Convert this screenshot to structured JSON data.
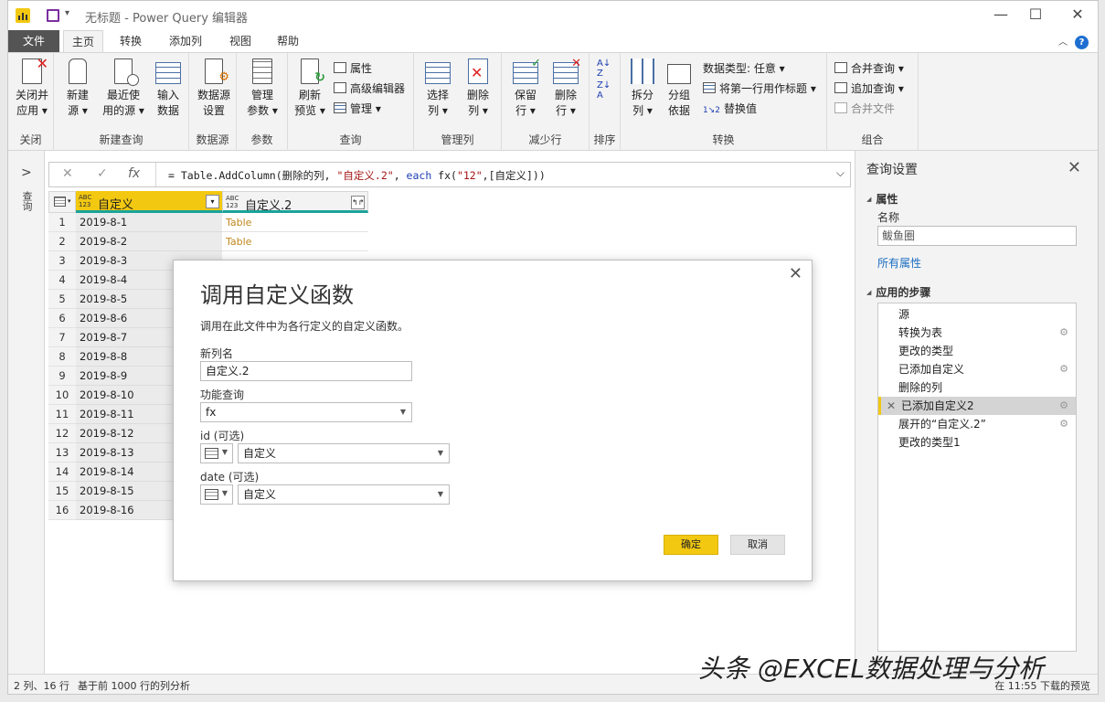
{
  "window": {
    "title": "无标题 - Power Query 编辑器",
    "controls": {
      "minimize": "—",
      "maximize": "☐",
      "close": "✕"
    }
  },
  "tabs": [
    {
      "label": "文件"
    },
    {
      "label": "主页"
    },
    {
      "label": "转换"
    },
    {
      "label": "添加列"
    },
    {
      "label": "视图"
    },
    {
      "label": "帮助"
    }
  ],
  "ribbon": {
    "groups": {
      "close": "关闭",
      "new_query": "新建查询",
      "data_source": "数据源",
      "params": "参数",
      "query": "查询",
      "manage_cols": "管理列",
      "reduce_rows": "减少行",
      "sort": "排序",
      "transform": "转换",
      "combine": "组合"
    },
    "buttons": {
      "close_apply": [
        "关闭并",
        "应用 ▾"
      ],
      "new_source": [
        "新建",
        "源 ▾"
      ],
      "recent_sources": [
        "最近使",
        "用的源 ▾"
      ],
      "enter_data": [
        "输入",
        "数据"
      ],
      "ds_settings": [
        "数据源",
        "设置"
      ],
      "manage_params": [
        "管理",
        "参数 ▾"
      ],
      "refresh_preview": [
        "刷新",
        "预览 ▾"
      ],
      "properties": "属性",
      "advanced_editor": "高级编辑器",
      "manage": "管理 ▾",
      "choose_cols": [
        "选择",
        "列 ▾"
      ],
      "remove_cols": [
        "删除",
        "列 ▾"
      ],
      "keep_rows": [
        "保留",
        "行 ▾"
      ],
      "remove_rows": [
        "删除",
        "行 ▾"
      ],
      "split_col": [
        "拆分",
        "列 ▾"
      ],
      "group_by": [
        "分组",
        "依据"
      ],
      "data_type": "数据类型: 任意 ▾",
      "first_row_header": "将第一行用作标题 ▾",
      "replace_values": "替换值",
      "merge_queries": "合并查询 ▾",
      "append_queries": "追加查询 ▾",
      "combine_files": "合并文件"
    }
  },
  "leftnav": {
    "label": "查询"
  },
  "formula_bar": {
    "cancel": "✕",
    "confirm": "✓",
    "fx": "fx",
    "parts": {
      "p1": "= Table.AddColumn(删除的列, ",
      "p2": "\"自定义.2\"",
      "p3": ", ",
      "p4": "each",
      "p5": " fx(",
      "p6": "\"12\"",
      "p7": ",[自定义]))"
    }
  },
  "grid": {
    "col1": {
      "type": "ABC\n123",
      "name": "自定义"
    },
    "col2": {
      "type": "ABC\n123",
      "name": "自定义.2"
    },
    "rows": [
      {
        "n": "1",
        "v1": "2019-8-1",
        "v2": "Table"
      },
      {
        "n": "2",
        "v1": "2019-8-2",
        "v2": "Table"
      },
      {
        "n": "3",
        "v1": "2019-8-3",
        "v2": ""
      },
      {
        "n": "4",
        "v1": "2019-8-4",
        "v2": ""
      },
      {
        "n": "5",
        "v1": "2019-8-5",
        "v2": ""
      },
      {
        "n": "6",
        "v1": "2019-8-6",
        "v2": ""
      },
      {
        "n": "7",
        "v1": "2019-8-7",
        "v2": ""
      },
      {
        "n": "8",
        "v1": "2019-8-8",
        "v2": ""
      },
      {
        "n": "9",
        "v1": "2019-8-9",
        "v2": ""
      },
      {
        "n": "10",
        "v1": "2019-8-10",
        "v2": ""
      },
      {
        "n": "11",
        "v1": "2019-8-11",
        "v2": ""
      },
      {
        "n": "12",
        "v1": "2019-8-12",
        "v2": ""
      },
      {
        "n": "13",
        "v1": "2019-8-13",
        "v2": ""
      },
      {
        "n": "14",
        "v1": "2019-8-14",
        "v2": ""
      },
      {
        "n": "15",
        "v1": "2019-8-15",
        "v2": ""
      },
      {
        "n": "16",
        "v1": "2019-8-16",
        "v2": ""
      }
    ]
  },
  "query_settings": {
    "title": "查询设置",
    "properties": "属性",
    "name_label": "名称",
    "name_value": "鲅鱼圈",
    "all_properties": "所有属性",
    "applied_steps": "应用的步骤",
    "steps": [
      {
        "label": "源",
        "gear": false,
        "selected": false
      },
      {
        "label": "转换为表",
        "gear": true,
        "selected": false
      },
      {
        "label": "更改的类型",
        "gear": false,
        "selected": false
      },
      {
        "label": "已添加自定义",
        "gear": true,
        "selected": false
      },
      {
        "label": "删除的列",
        "gear": false,
        "selected": false
      },
      {
        "label": "已添加自定义2",
        "gear": true,
        "selected": true
      },
      {
        "label": "展开的“自定义.2”",
        "gear": true,
        "selected": false
      },
      {
        "label": "更改的类型1",
        "gear": false,
        "selected": false
      }
    ]
  },
  "status": {
    "left": "2 列、16 行",
    "middle": "基于前 1000 行的列分析",
    "right": "在 11:55 下载的预览"
  },
  "dialog": {
    "title": "调用自定义函数",
    "description": "调用在此文件中为各行定义的自定义函数。",
    "new_col_label": "新列名",
    "new_col_value": "自定义.2",
    "func_label": "功能查询",
    "func_value": "fx",
    "id_label": "id (可选)",
    "id_value": "自定义",
    "date_label": "date (可选)",
    "date_value": "自定义",
    "ok": "确定",
    "cancel": "取消"
  },
  "watermark": "头条 @EXCEL数据处理与分析"
}
